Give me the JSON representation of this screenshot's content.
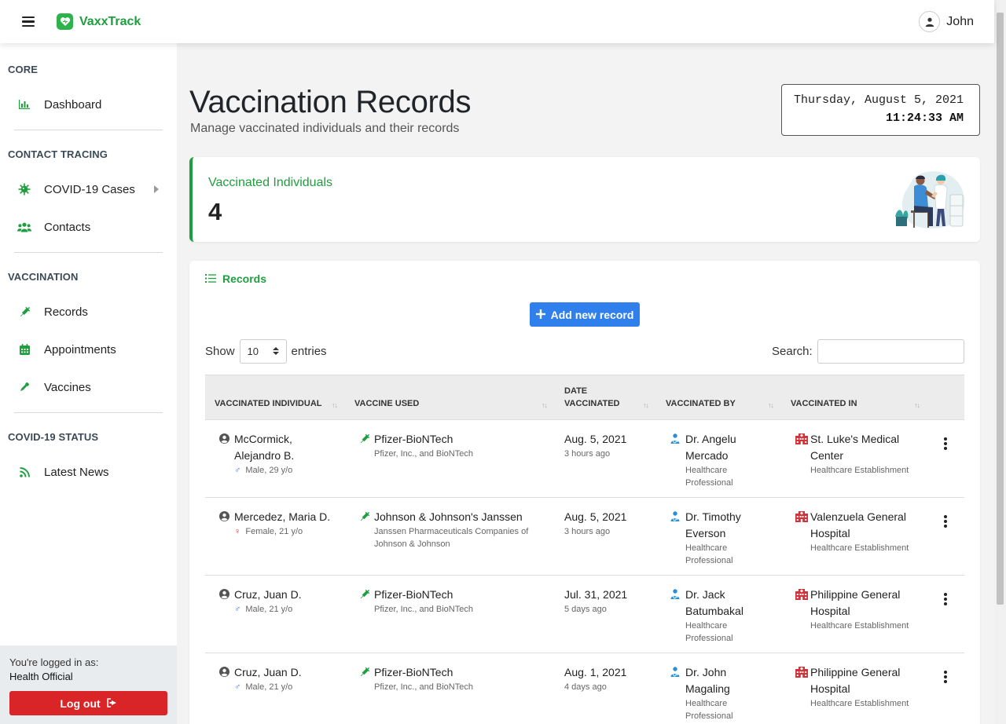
{
  "app": {
    "name": "VaxxTrack",
    "user": "John"
  },
  "sidebar": {
    "sections": [
      {
        "heading": "CORE",
        "items": [
          {
            "label": "Dashboard",
            "icon": "bar-chart-icon"
          }
        ]
      },
      {
        "heading": "CONTACT TRACING",
        "items": [
          {
            "label": "COVID-19 Cases",
            "icon": "virus-icon"
          },
          {
            "label": "Contacts",
            "icon": "users-icon"
          }
        ]
      },
      {
        "heading": "VACCINATION",
        "items": [
          {
            "label": "Records",
            "icon": "syringe-icon"
          },
          {
            "label": "Appointments",
            "icon": "calendar-icon"
          },
          {
            "label": "Vaccines",
            "icon": "eyedropper-icon"
          }
        ]
      },
      {
        "heading": "COVID-19 STATUS",
        "items": [
          {
            "label": "Latest News",
            "icon": "rss-icon"
          }
        ]
      }
    ],
    "footer": {
      "logged_in_as": "You're logged in as:",
      "role": "Health Official",
      "logout": "Log out"
    }
  },
  "page": {
    "title": "Vaccination Records",
    "subtitle": "Manage vaccinated individuals and their records"
  },
  "clock": {
    "date": "Thursday, August 5, 2021",
    "time": "11:24:33 AM"
  },
  "stat": {
    "label": "Vaccinated Individuals",
    "value": "4"
  },
  "records": {
    "title": "Records",
    "add_button": "Add new record",
    "show_label": "Show",
    "entries_value": "10",
    "entries_label": "entries",
    "search_label": "Search:",
    "search_value": "",
    "columns": [
      {
        "line1": "VACCINATED INDIVIDUAL",
        "line2": ""
      },
      {
        "line1": "VACCINE USED",
        "line2": ""
      },
      {
        "line1": "DATE",
        "line2": "VACCINATED"
      },
      {
        "line1": "VACCINATED BY",
        "line2": ""
      },
      {
        "line1": "VACCINATED IN",
        "line2": ""
      }
    ],
    "rows": [
      {
        "name1": "McCormick,",
        "name2": "Alejandro B.",
        "sex_symbol": "♂",
        "sex": "male",
        "sex_age": "Male, 29 y/o",
        "vaccine": "Pfizer-BioNTech",
        "maker1": "Pfizer, Inc., and BioNTech",
        "maker2": "",
        "date": "Aug. 5, 2021",
        "ago": "3 hours ago",
        "by1": "Dr. Angelu",
        "by2": "Mercado",
        "role1": "Healthcare",
        "role2": "Professional",
        "in1": "St. Luke's Medical",
        "in2": "Center",
        "in_type": "Healthcare Establishment"
      },
      {
        "name1": "Mercedez, Maria D.",
        "name2": "",
        "sex_symbol": "♀",
        "sex": "female",
        "sex_age": "Female, 21 y/o",
        "vaccine": "Johnson & Johnson's Janssen",
        "maker1": "Janssen Pharmaceuticals Companies of",
        "maker2": "Johnson & Johnson",
        "date": "Aug. 5, 2021",
        "ago": "3 hours ago",
        "by1": "Dr. Timothy",
        "by2": "Everson",
        "role1": "Healthcare",
        "role2": "Professional",
        "in1": "Valenzuela General",
        "in2": "Hospital",
        "in_type": "Healthcare Establishment"
      },
      {
        "name1": "Cruz, Juan D.",
        "name2": "",
        "sex_symbol": "♂",
        "sex": "male",
        "sex_age": "Male, 21 y/o",
        "vaccine": "Pfizer-BioNTech",
        "maker1": "Pfizer, Inc., and BioNTech",
        "maker2": "",
        "date": "Jul. 31, 2021",
        "ago": "5 days ago",
        "by1": "Dr. Jack",
        "by2": "Batumbakal",
        "role1": "Healthcare",
        "role2": "Professional",
        "in1": "Philippine General",
        "in2": "Hospital",
        "in_type": "Healthcare Establishment"
      },
      {
        "name1": "Cruz, Juan D.",
        "name2": "",
        "sex_symbol": "♂",
        "sex": "male",
        "sex_age": "Male, 21 y/o",
        "vaccine": "Pfizer-BioNTech",
        "maker1": "Pfizer, Inc., and BioNTech",
        "maker2": "",
        "date": "Aug. 1, 2021",
        "ago": "4 days ago",
        "by1": "Dr. John",
        "by2": "Magaling",
        "role1": "Healthcare",
        "role2": "Professional",
        "in1": "Philippine General",
        "in2": "Hospital",
        "in_type": "Healthcare Establishment"
      }
    ]
  },
  "colors": {
    "brand": "#1e9e3e",
    "primary": "#2f80ed",
    "danger": "#d92528",
    "male": "#3a6bd6",
    "female": "#d0343a"
  }
}
